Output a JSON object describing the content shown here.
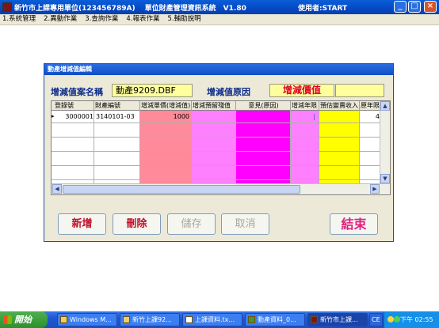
{
  "window": {
    "title": "新竹市上課專用單位(123456789A)　 單位財產管理資訊系統　V1.80",
    "user_label": "使用者:START",
    "minimize": "_",
    "maximize": "□",
    "close": "×"
  },
  "menu": [
    "1.系統管理",
    "2.異動作業",
    "3.查詢作業",
    "4.報表作業",
    "5.輔助說明"
  ],
  "dialog": {
    "title": "動產增減值編輯",
    "case_label": "增減值案名稱",
    "case_value": "動產9209.DBF",
    "reason_label": "增減值原因",
    "reason_value": "增減價值",
    "reason_extra": ""
  },
  "grid": {
    "headers": [
      "登錄號",
      "財產編號",
      "增減單價(增減值)",
      "增減預留殘值",
      "意見(原因)",
      "增減年限",
      "預估變賣收入",
      "原年限"
    ],
    "row_marker": "▸",
    "row": {
      "reg_no": "3000001",
      "asset_no": "3140101-03",
      "amount": "1000",
      "years": "|",
      "orig_years": "4"
    }
  },
  "buttons": {
    "add": "新增",
    "delete": "刪除",
    "save": "儲存",
    "cancel": "取消",
    "exit": "結束"
  },
  "taskbar": {
    "start": "開始",
    "tasks": [
      "Windows M...",
      "新竹上課92...",
      "上課資料.tx...",
      "動產資料_0...",
      "新竹市上課..."
    ],
    "lang": "CE",
    "time": "下午 02:55"
  },
  "colors": {
    "pink_col": "#ff8a9a",
    "light_pink_col": "#ff80ff",
    "magenta_col": "#ff00ff",
    "yellow_col": "#ffff00",
    "field_bg": "#ffff9c"
  }
}
